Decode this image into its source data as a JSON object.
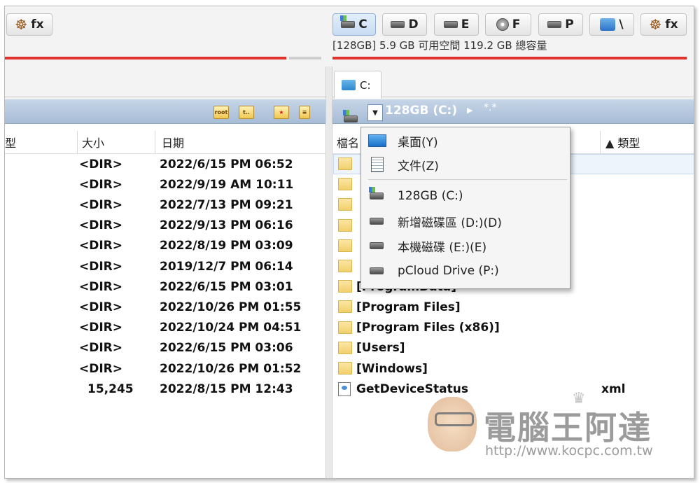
{
  "left_toolbar": {
    "fx_label": "fx"
  },
  "drives": [
    {
      "letter": "C",
      "active": true,
      "type": "system"
    },
    {
      "letter": "D",
      "active": false,
      "type": "disk"
    },
    {
      "letter": "E",
      "active": false,
      "type": "disk"
    },
    {
      "letter": "F",
      "active": false,
      "type": "cd"
    },
    {
      "letter": "P",
      "active": false,
      "type": "disk"
    },
    {
      "letter": "\\",
      "active": false,
      "type": "network"
    },
    {
      "letter": "fx",
      "active": false,
      "type": "plugin"
    }
  ],
  "drive_info": "[128GB]  5.9 GB 可用空間 119.2 GB 總容量",
  "right_tab": {
    "label": "C:"
  },
  "right_path": {
    "current": "128GB (C:)",
    "parent": "*.*"
  },
  "left_panel": {
    "columns": {
      "type": "型",
      "size": "大小",
      "date": "日期"
    },
    "toolbar_icons": [
      "root-icon",
      "up-icon",
      "star-icon",
      "list-icon"
    ],
    "rows": [
      {
        "size": "<DIR>",
        "date": "2022/6/15 PM 06:52"
      },
      {
        "size": "<DIR>",
        "date": "2022/9/19 AM 10:11"
      },
      {
        "size": "<DIR>",
        "date": "2022/7/13 PM 09:21"
      },
      {
        "size": "<DIR>",
        "date": "2022/9/13 PM 06:16"
      },
      {
        "size": "<DIR>",
        "date": "2022/8/19 PM 03:09"
      },
      {
        "size": "<DIR>",
        "date": "2019/12/7 PM 06:14"
      },
      {
        "size": "<DIR>",
        "date": "2022/6/15 PM 03:01"
      },
      {
        "size": "<DIR>",
        "date": "2022/10/26 PM 01:55"
      },
      {
        "size": "<DIR>",
        "date": "2022/10/24 PM 04:51"
      },
      {
        "size": "<DIR>",
        "date": "2022/6/15 PM 03:06"
      },
      {
        "size": "<DIR>",
        "date": "2022/10/26 PM 01:52"
      },
      {
        "size": "15,245",
        "date": "2022/8/15 PM 12:43"
      }
    ]
  },
  "right_panel": {
    "columns": {
      "name": "檔名",
      "type": "▲ 類型"
    },
    "rows": [
      {
        "name": "",
        "kind": "folder",
        "type": ""
      },
      {
        "name": "",
        "kind": "folder",
        "type": ""
      },
      {
        "name": "",
        "kind": "folder",
        "type": ""
      },
      {
        "name": "",
        "kind": "folder",
        "type": ""
      },
      {
        "name": "",
        "kind": "folder",
        "type": ""
      },
      {
        "name": "",
        "kind": "folder",
        "type": ""
      },
      {
        "name": "[ProgramData]",
        "kind": "folder",
        "type": ""
      },
      {
        "name": "[Program Files]",
        "kind": "folder",
        "type": ""
      },
      {
        "name": "[Program Files (x86)]",
        "kind": "folder",
        "type": ""
      },
      {
        "name": "[Users]",
        "kind": "folder",
        "type": ""
      },
      {
        "name": "[Windows]",
        "kind": "folder",
        "type": ""
      },
      {
        "name": "GetDeviceStatus",
        "kind": "file",
        "type": "xml"
      }
    ]
  },
  "dropdown_menu": {
    "items": [
      {
        "label": "桌面(Y)",
        "icon": "desktop-icon"
      },
      {
        "label": "文件(Z)",
        "icon": "document-icon"
      },
      {
        "label": "128GB (C:)",
        "icon": "system-drive-icon"
      },
      {
        "label": "新增磁碟區 (D:)(D)",
        "icon": "drive-icon"
      },
      {
        "label": "本機磁碟 (E:)(E)",
        "icon": "drive-icon"
      },
      {
        "label": "pCloud Drive (P:)",
        "icon": "drive-icon"
      }
    ]
  },
  "watermark": {
    "title": "電腦王阿達",
    "url": "http://www.kocpc.com.tw"
  },
  "colors": {
    "accent_red": "#e0322c",
    "path_bar": "#a7bcd6",
    "folder": "#f1cf6b"
  }
}
